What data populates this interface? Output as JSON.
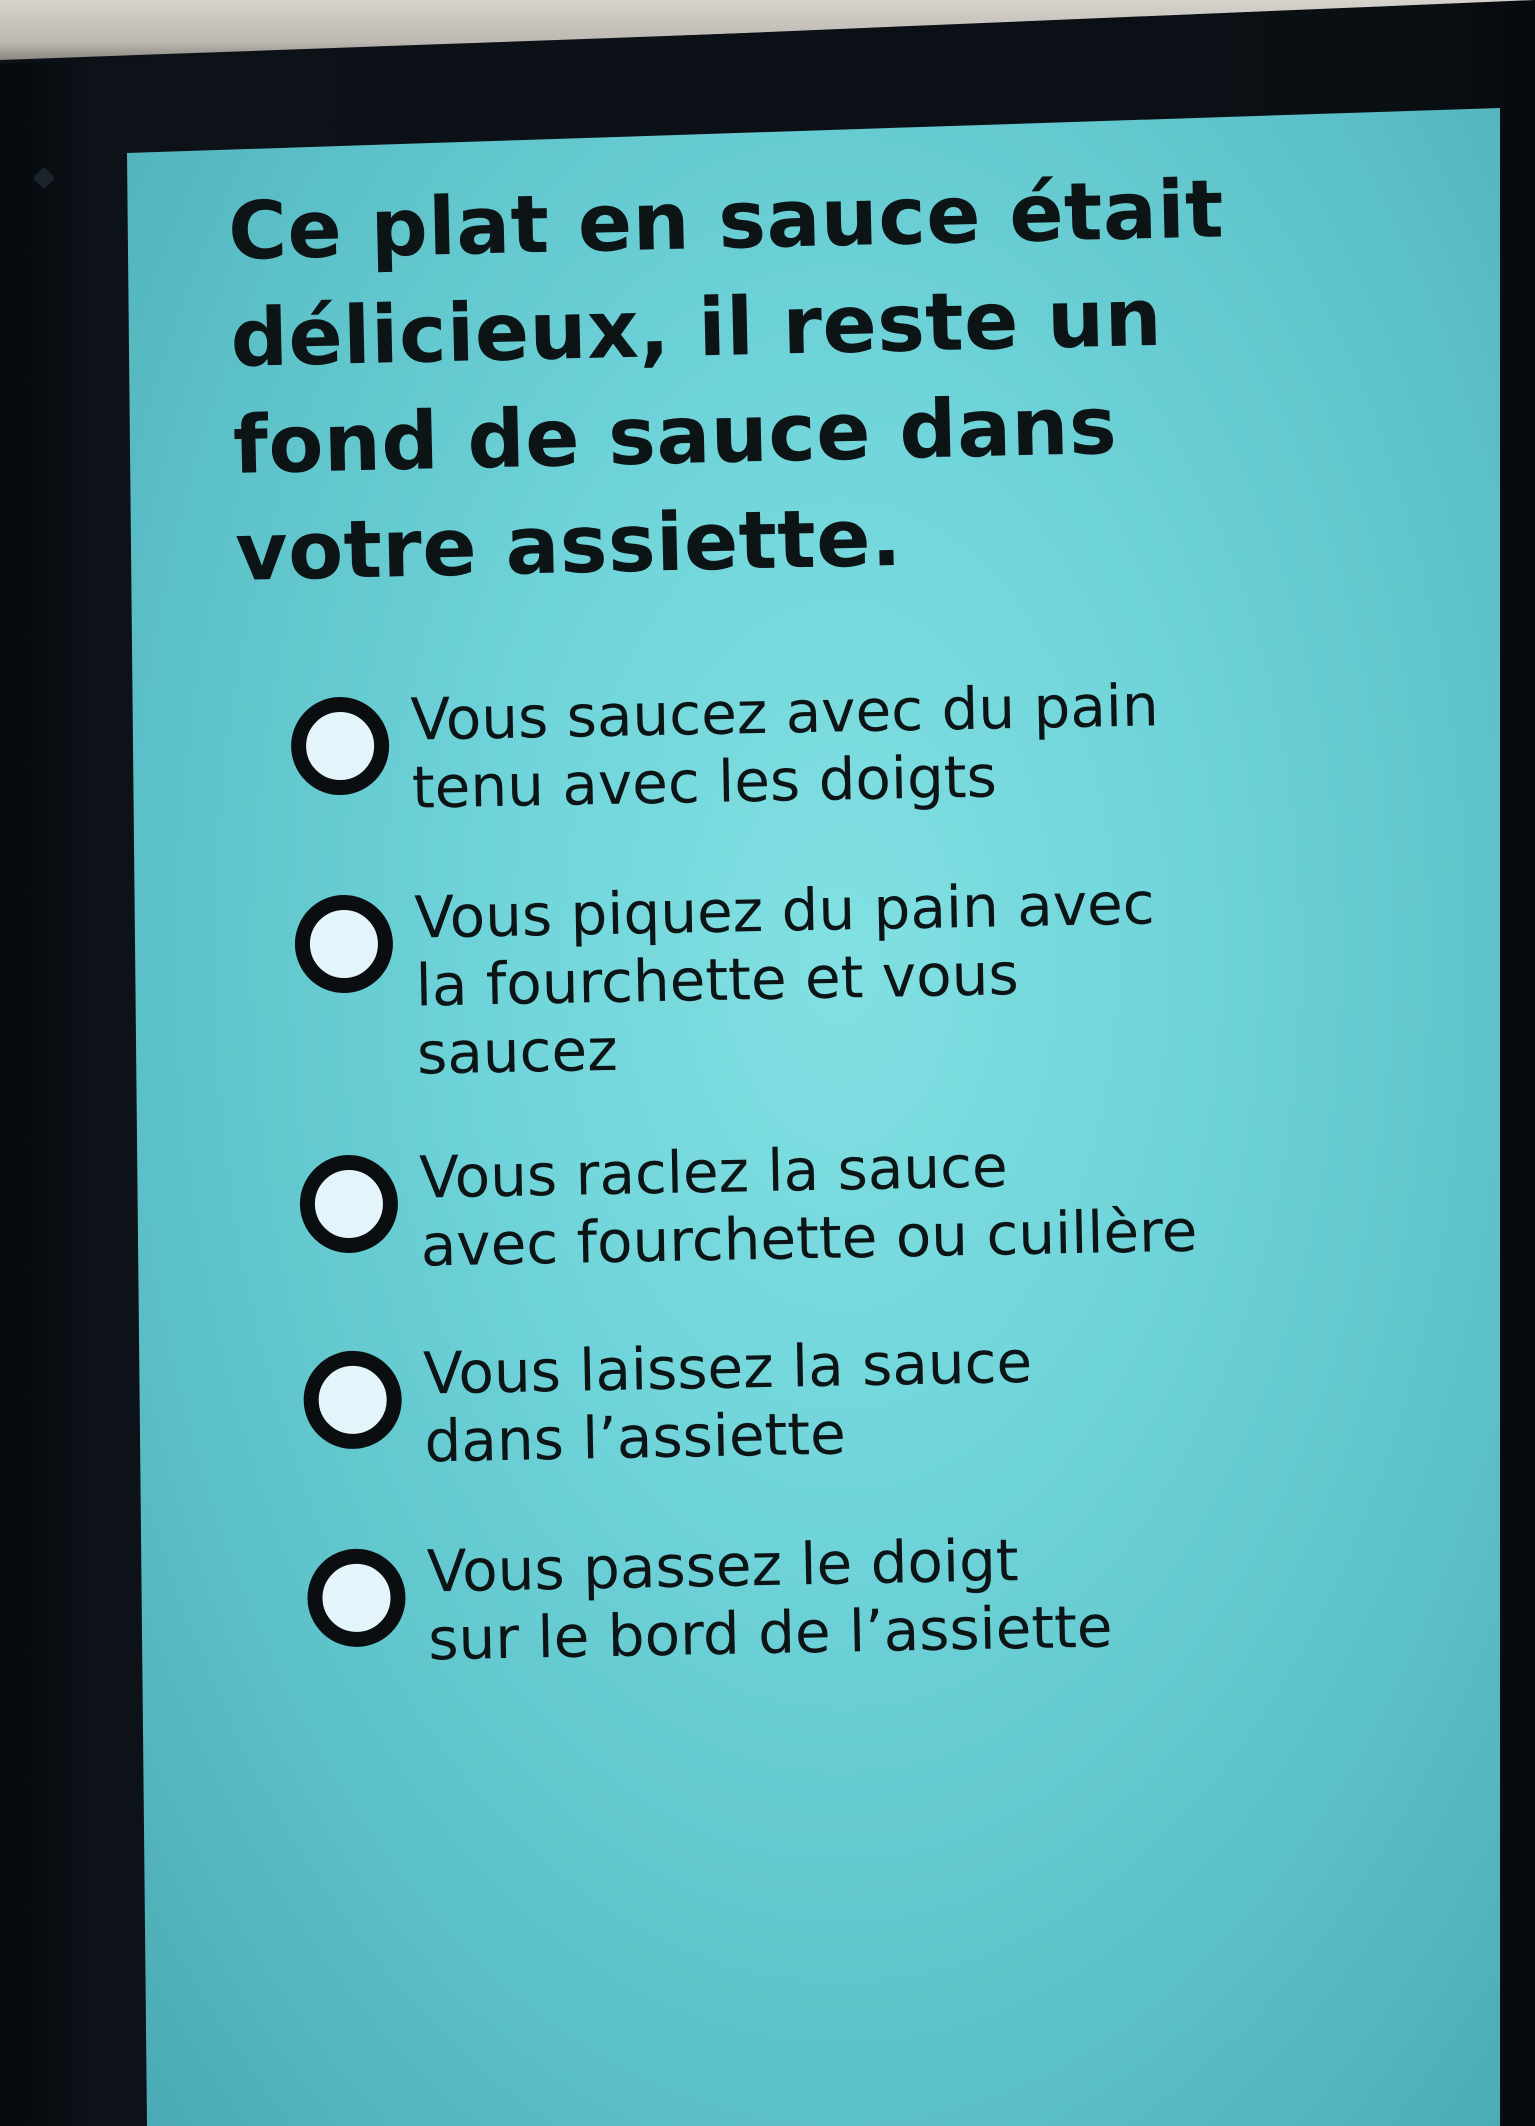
{
  "question": {
    "title": "Ce plat en sauce était\ndélicieux, il reste un\nfond de sauce dans\nvotre assiette."
  },
  "options": [
    {
      "label": "Vous saucez avec du pain\ntenu avec les doigts",
      "selected": false
    },
    {
      "label": "Vous piquez du pain avec\nla fourchette et vous\nsaucez",
      "selected": false
    },
    {
      "label": "Vous raclez la sauce\navec fourchette ou cuillère",
      "selected": false
    },
    {
      "label": "Vous laissez la sauce\ndans l’assiette",
      "selected": false
    },
    {
      "label": "Vous passez le doigt\nsur le bord de l’assiette",
      "selected": false
    }
  ],
  "colors": {
    "screen": "#6fd4d9",
    "text": "#0c1416",
    "radio_border": "#0a0e10",
    "radio_fill": "#e4f4fb"
  }
}
